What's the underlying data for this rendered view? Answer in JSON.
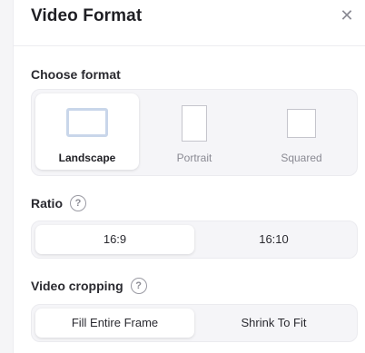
{
  "dialog": {
    "title": "Video Format",
    "close_icon": "close-icon"
  },
  "format": {
    "label": "Choose format",
    "options": [
      {
        "label": "Landscape",
        "selected": true
      },
      {
        "label": "Portrait",
        "selected": false
      },
      {
        "label": "Squared",
        "selected": false
      }
    ]
  },
  "ratio": {
    "label": "Ratio",
    "options": [
      {
        "label": "16:9",
        "selected": true
      },
      {
        "label": "16:10",
        "selected": false
      }
    ]
  },
  "cropping": {
    "label": "Video cropping",
    "options": [
      {
        "label": "Fill Entire Frame",
        "selected": true
      },
      {
        "label": "Shrink To Fit",
        "selected": false
      }
    ]
  },
  "help_icon_glyph": "?",
  "close_glyph": "✕",
  "colors": {
    "selected_outline": "#c9d6ea",
    "panel_bg": "#f5f5f8"
  }
}
